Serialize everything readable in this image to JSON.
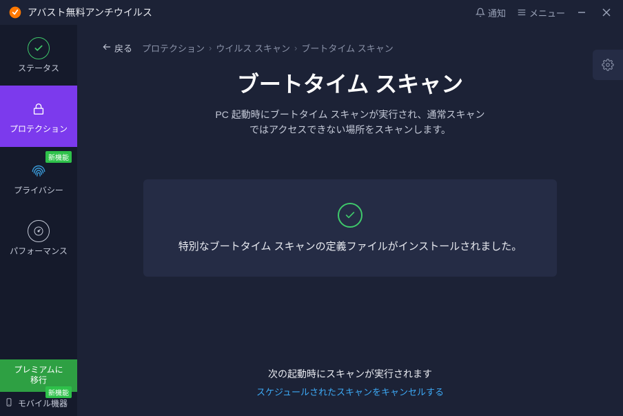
{
  "titlebar": {
    "app_name": "アバスト無料アンチウイルス",
    "notify_label": "通知",
    "menu_label": "メニュー"
  },
  "sidebar": {
    "status_label": "ステータス",
    "protection_label": "プロテクション",
    "privacy_label": "プライバシー",
    "privacy_badge": "新機能",
    "performance_label": "パフォーマンス",
    "premium_line1": "プレミアムに",
    "premium_line2": "移行",
    "mobile_badge": "新機能",
    "mobile_label": "モバイル機器"
  },
  "breadcrumb": {
    "back_label": "戻る",
    "items": [
      "プロテクション",
      "ウイルス スキャン",
      "ブートタイム スキャン"
    ]
  },
  "page": {
    "title": "ブートタイム スキャン",
    "description": "PC 起動時にブートタイム スキャンが実行され、通常スキャン\nではアクセスできない場所をスキャンします。"
  },
  "status": {
    "message": "特別なブートタイム スキャンの定義ファイルがインストールされました。"
  },
  "footer": {
    "line1": "次の起動時にスキャンが実行されます",
    "cancel_link": "スケジュールされたスキャンをキャンセルする"
  }
}
